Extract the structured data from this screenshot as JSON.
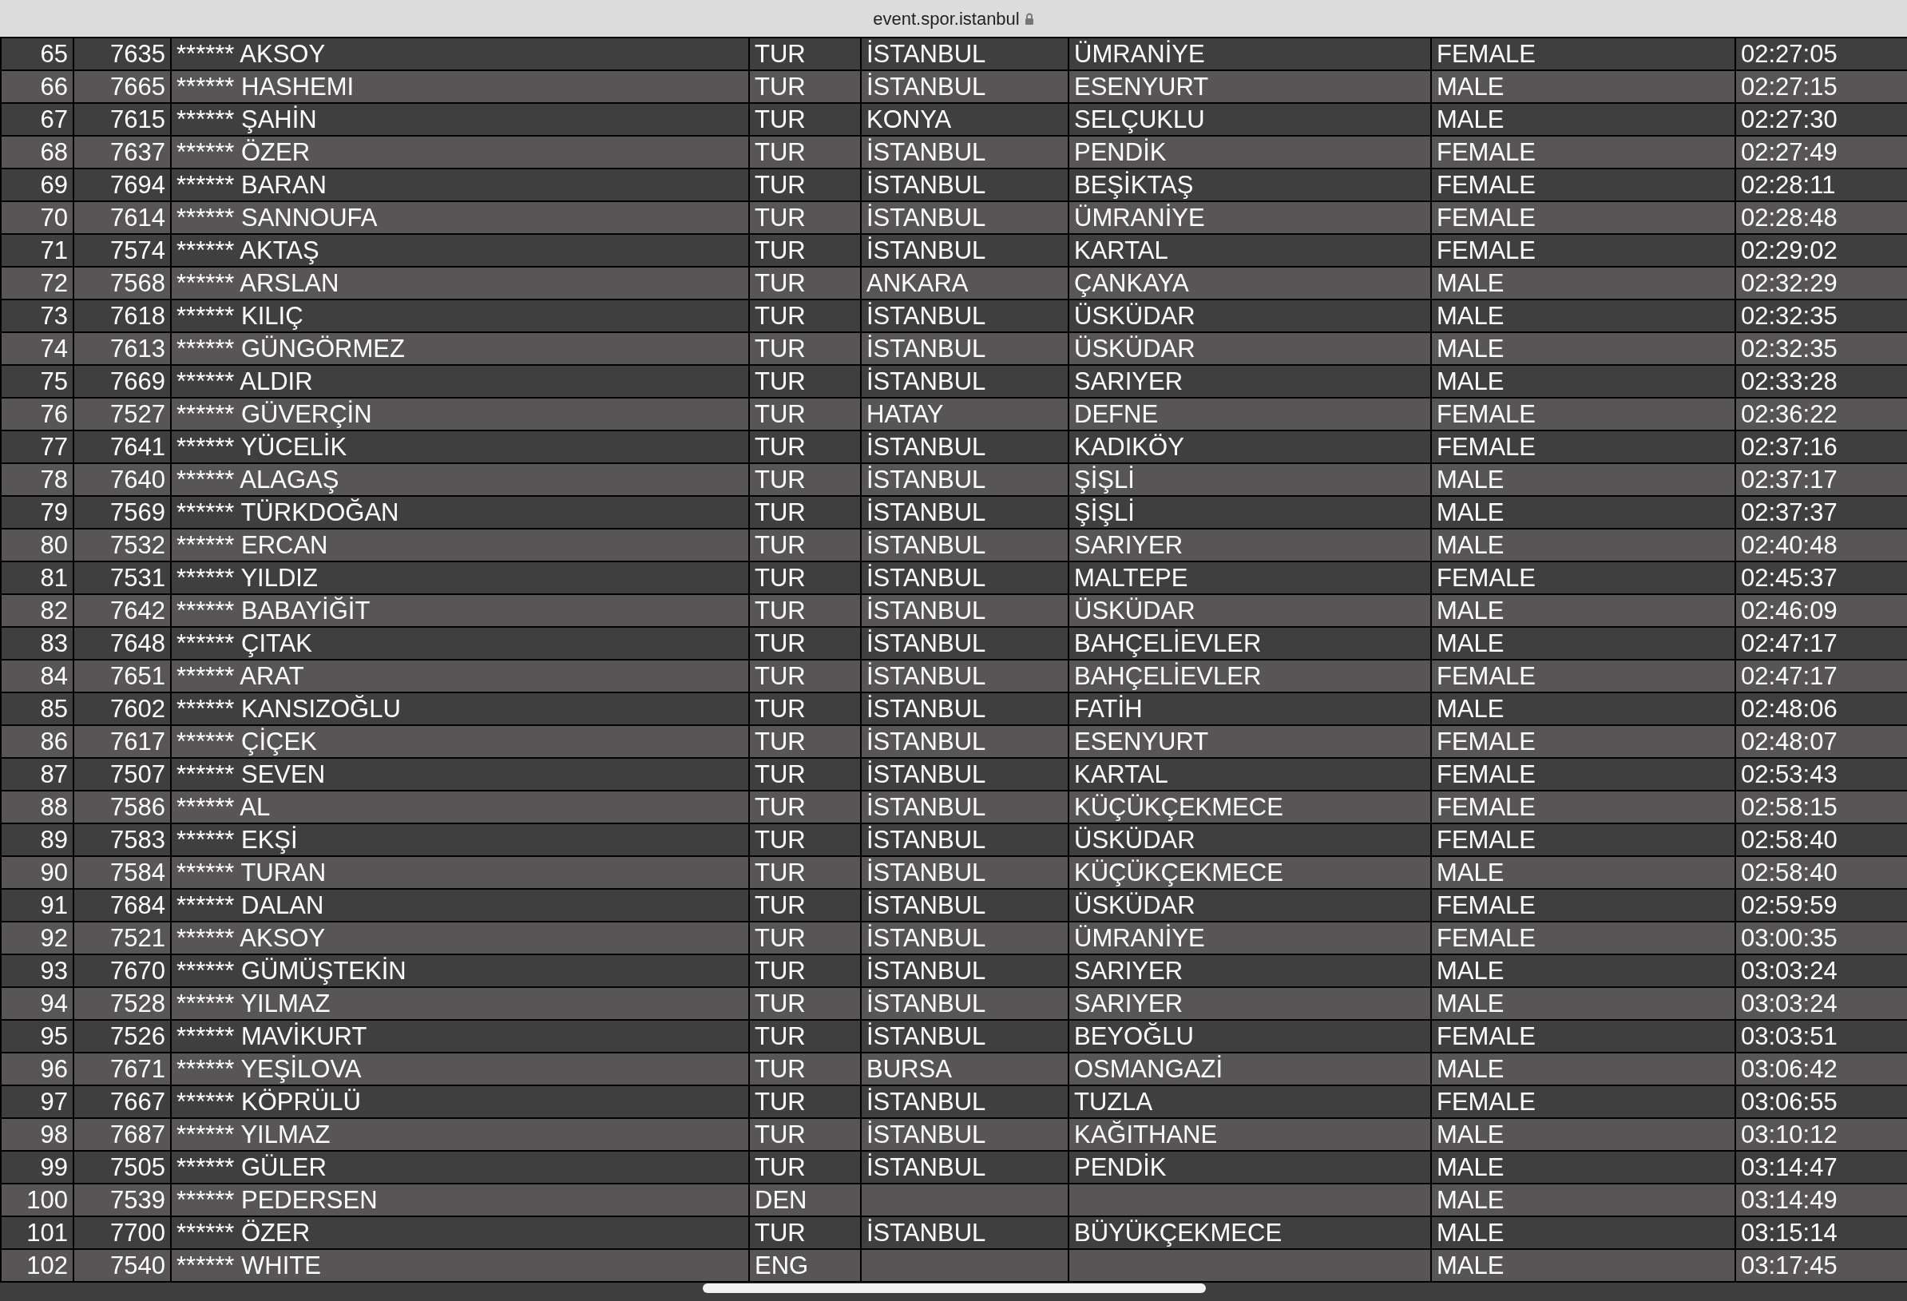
{
  "address_bar": {
    "url": "event.spor.istanbul"
  },
  "table": {
    "rows": [
      {
        "rank": "65",
        "bib": "7635",
        "name": "****** AKSOY",
        "country": "TUR",
        "city": "İSTANBUL",
        "district": "ÜMRANİYE",
        "gender": "FEMALE",
        "time": "02:27:05"
      },
      {
        "rank": "66",
        "bib": "7665",
        "name": "****** HASHEMI",
        "country": "TUR",
        "city": "İSTANBUL",
        "district": "ESENYURT",
        "gender": "MALE",
        "time": "02:27:15"
      },
      {
        "rank": "67",
        "bib": "7615",
        "name": "****** ŞAHİN",
        "country": "TUR",
        "city": "KONYA",
        "district": "SELÇUKLU",
        "gender": "MALE",
        "time": "02:27:30"
      },
      {
        "rank": "68",
        "bib": "7637",
        "name": "****** ÖZER",
        "country": "TUR",
        "city": "İSTANBUL",
        "district": "PENDİK",
        "gender": "FEMALE",
        "time": "02:27:49"
      },
      {
        "rank": "69",
        "bib": "7694",
        "name": "****** BARAN",
        "country": "TUR",
        "city": "İSTANBUL",
        "district": "BEŞİKTAŞ",
        "gender": "FEMALE",
        "time": "02:28:11"
      },
      {
        "rank": "70",
        "bib": "7614",
        "name": "****** SANNOUFA",
        "country": "TUR",
        "city": "İSTANBUL",
        "district": "ÜMRANİYE",
        "gender": "FEMALE",
        "time": "02:28:48"
      },
      {
        "rank": "71",
        "bib": "7574",
        "name": "****** AKTAŞ",
        "country": "TUR",
        "city": "İSTANBUL",
        "district": "KARTAL",
        "gender": "FEMALE",
        "time": "02:29:02"
      },
      {
        "rank": "72",
        "bib": "7568",
        "name": "****** ARSLAN",
        "country": "TUR",
        "city": "ANKARA",
        "district": "ÇANKAYA",
        "gender": "MALE",
        "time": "02:32:29"
      },
      {
        "rank": "73",
        "bib": "7618",
        "name": "****** KILIÇ",
        "country": "TUR",
        "city": "İSTANBUL",
        "district": "ÜSKÜDAR",
        "gender": "MALE",
        "time": "02:32:35"
      },
      {
        "rank": "74",
        "bib": "7613",
        "name": "****** GÜNGÖRMEZ",
        "country": "TUR",
        "city": "İSTANBUL",
        "district": "ÜSKÜDAR",
        "gender": "MALE",
        "time": "02:32:35"
      },
      {
        "rank": "75",
        "bib": "7669",
        "name": "****** ALDIR",
        "country": "TUR",
        "city": "İSTANBUL",
        "district": "SARIYER",
        "gender": "MALE",
        "time": "02:33:28"
      },
      {
        "rank": "76",
        "bib": "7527",
        "name": "****** GÜVERÇİN",
        "country": "TUR",
        "city": "HATAY",
        "district": "DEFNE",
        "gender": "FEMALE",
        "time": "02:36:22"
      },
      {
        "rank": "77",
        "bib": "7641",
        "name": "****** YÜCELİK",
        "country": "TUR",
        "city": "İSTANBUL",
        "district": "KADIKÖY",
        "gender": "FEMALE",
        "time": "02:37:16"
      },
      {
        "rank": "78",
        "bib": "7640",
        "name": "****** ALAGAŞ",
        "country": "TUR",
        "city": "İSTANBUL",
        "district": "ŞİŞLİ",
        "gender": "MALE",
        "time": "02:37:17"
      },
      {
        "rank": "79",
        "bib": "7569",
        "name": "****** TÜRKDOĞAN",
        "country": "TUR",
        "city": "İSTANBUL",
        "district": "ŞİŞLİ",
        "gender": "MALE",
        "time": "02:37:37"
      },
      {
        "rank": "80",
        "bib": "7532",
        "name": "****** ERCAN",
        "country": "TUR",
        "city": "İSTANBUL",
        "district": "SARIYER",
        "gender": "MALE",
        "time": "02:40:48"
      },
      {
        "rank": "81",
        "bib": "7531",
        "name": "****** YILDIZ",
        "country": "TUR",
        "city": "İSTANBUL",
        "district": "MALTEPE",
        "gender": "FEMALE",
        "time": "02:45:37"
      },
      {
        "rank": "82",
        "bib": "7642",
        "name": "****** BABAYİĞİT",
        "country": "TUR",
        "city": "İSTANBUL",
        "district": "ÜSKÜDAR",
        "gender": "MALE",
        "time": "02:46:09"
      },
      {
        "rank": "83",
        "bib": "7648",
        "name": "****** ÇITAK",
        "country": "TUR",
        "city": "İSTANBUL",
        "district": "BAHÇELİEVLER",
        "gender": "MALE",
        "time": "02:47:17"
      },
      {
        "rank": "84",
        "bib": "7651",
        "name": "****** ARAT",
        "country": "TUR",
        "city": "İSTANBUL",
        "district": "BAHÇELİEVLER",
        "gender": "FEMALE",
        "time": "02:47:17"
      },
      {
        "rank": "85",
        "bib": "7602",
        "name": "****** KANSIZOĞLU",
        "country": "TUR",
        "city": "İSTANBUL",
        "district": "FATİH",
        "gender": "MALE",
        "time": "02:48:06"
      },
      {
        "rank": "86",
        "bib": "7617",
        "name": "****** ÇİÇEK",
        "country": "TUR",
        "city": "İSTANBUL",
        "district": "ESENYURT",
        "gender": "FEMALE",
        "time": "02:48:07"
      },
      {
        "rank": "87",
        "bib": "7507",
        "name": "****** SEVEN",
        "country": "TUR",
        "city": "İSTANBUL",
        "district": "KARTAL",
        "gender": "FEMALE",
        "time": "02:53:43"
      },
      {
        "rank": "88",
        "bib": "7586",
        "name": "****** AL",
        "country": "TUR",
        "city": "İSTANBUL",
        "district": "KÜÇÜKÇEKMECE",
        "gender": "FEMALE",
        "time": "02:58:15"
      },
      {
        "rank": "89",
        "bib": "7583",
        "name": "****** EKŞİ",
        "country": "TUR",
        "city": "İSTANBUL",
        "district": "ÜSKÜDAR",
        "gender": "FEMALE",
        "time": "02:58:40"
      },
      {
        "rank": "90",
        "bib": "7584",
        "name": "****** TURAN",
        "country": "TUR",
        "city": "İSTANBUL",
        "district": "KÜÇÜKÇEKMECE",
        "gender": "MALE",
        "time": "02:58:40"
      },
      {
        "rank": "91",
        "bib": "7684",
        "name": "****** DALAN",
        "country": "TUR",
        "city": "İSTANBUL",
        "district": "ÜSKÜDAR",
        "gender": "FEMALE",
        "time": "02:59:59"
      },
      {
        "rank": "92",
        "bib": "7521",
        "name": "****** AKSOY",
        "country": "TUR",
        "city": "İSTANBUL",
        "district": "ÜMRANİYE",
        "gender": "FEMALE",
        "time": "03:00:35"
      },
      {
        "rank": "93",
        "bib": "7670",
        "name": "****** GÜMÜŞTEKİN",
        "country": "TUR",
        "city": "İSTANBUL",
        "district": "SARIYER",
        "gender": "MALE",
        "time": "03:03:24"
      },
      {
        "rank": "94",
        "bib": "7528",
        "name": "****** YILMAZ",
        "country": "TUR",
        "city": "İSTANBUL",
        "district": "SARIYER",
        "gender": "MALE",
        "time": "03:03:24"
      },
      {
        "rank": "95",
        "bib": "7526",
        "name": "****** MAVİKURT",
        "country": "TUR",
        "city": "İSTANBUL",
        "district": "BEYOĞLU",
        "gender": "FEMALE",
        "time": "03:03:51"
      },
      {
        "rank": "96",
        "bib": "7671",
        "name": "****** YEŞİLOVA",
        "country": "TUR",
        "city": "BURSA",
        "district": "OSMANGAZİ",
        "gender": "MALE",
        "time": "03:06:42"
      },
      {
        "rank": "97",
        "bib": "7667",
        "name": "****** KÖPRÜLÜ",
        "country": "TUR",
        "city": "İSTANBUL",
        "district": "TUZLA",
        "gender": "FEMALE",
        "time": "03:06:55"
      },
      {
        "rank": "98",
        "bib": "7687",
        "name": "****** YILMAZ",
        "country": "TUR",
        "city": "İSTANBUL",
        "district": "KAĞITHANE",
        "gender": "MALE",
        "time": "03:10:12"
      },
      {
        "rank": "99",
        "bib": "7505",
        "name": "****** GÜLER",
        "country": "TUR",
        "city": "İSTANBUL",
        "district": "PENDİK",
        "gender": "MALE",
        "time": "03:14:47"
      },
      {
        "rank": "100",
        "bib": "7539",
        "name": "****** PEDERSEN",
        "country": "DEN",
        "gender": "MALE",
        "time": "03:14:49"
      },
      {
        "rank": "101",
        "bib": "7700",
        "name": "****** ÖZER",
        "country": "TUR",
        "city": "İSTANBUL",
        "district": "BÜYÜKÇEKMECE",
        "gender": "MALE",
        "time": "03:15:14"
      },
      {
        "rank": "102",
        "bib": "7540",
        "name": "****** WHITE",
        "country": "ENG",
        "gender": "MALE",
        "time": "03:17:45"
      }
    ]
  }
}
